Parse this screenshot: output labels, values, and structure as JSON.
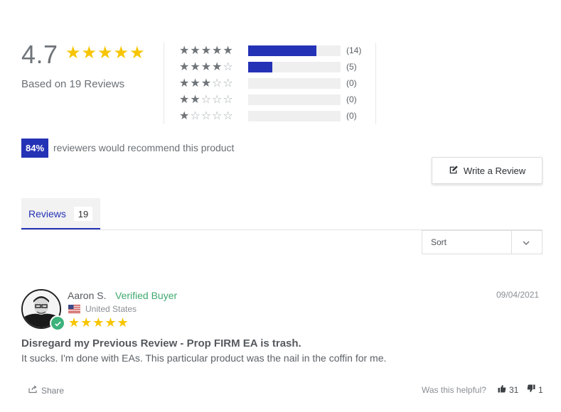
{
  "summary": {
    "average": "4.7",
    "stars": "★★★★★",
    "based_on": "Based on 19 Reviews",
    "recommend_percent": "84%",
    "recommend_text": "reviewers would recommend this product",
    "write_review_label": "Write a Review"
  },
  "histogram": [
    {
      "filled": "★★★★★",
      "empty": "",
      "fraction": 0.737,
      "count": "(14)"
    },
    {
      "filled": "★★★★",
      "empty": "☆",
      "fraction": 0.263,
      "count": "(5)"
    },
    {
      "filled": "★★★",
      "empty": "☆☆",
      "fraction": 0,
      "count": "(0)"
    },
    {
      "filled": "★★",
      "empty": "☆☆☆",
      "fraction": 0,
      "count": "(0)"
    },
    {
      "filled": "★",
      "empty": "☆☆☆☆",
      "fraction": 0,
      "count": "(0)"
    }
  ],
  "tabs": {
    "reviews_label": "Reviews",
    "reviews_count": "19"
  },
  "sort": {
    "label": "Sort"
  },
  "review": {
    "author": "Aaron S.",
    "verified": "Verified Buyer",
    "country": "United States",
    "stars": "★★★★★",
    "date": "09/04/2021",
    "title": "Disregard my Previous Review - Prop FIRM EA is trash.",
    "body": "It sucks. I'm done with EAs. This particular product was the nail in the coffin for me.",
    "share_label": "Share",
    "helpful_label": "Was this helpful?",
    "upvotes": "31",
    "downvotes": "1"
  },
  "colors": {
    "accent": "#2432b6",
    "star": "#f7c500",
    "verified": "#3fa96f"
  }
}
